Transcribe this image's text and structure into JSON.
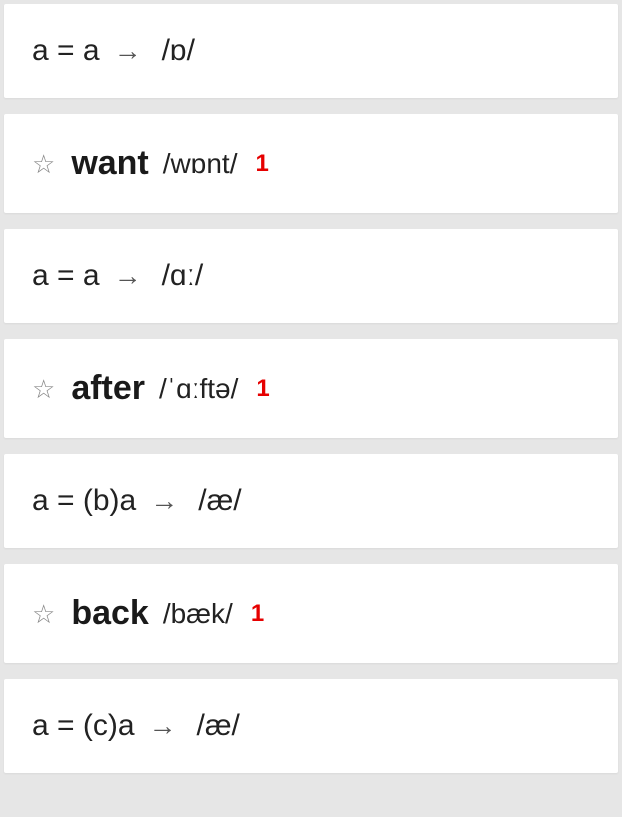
{
  "cards": [
    {
      "type": "rule",
      "lhs": "a = a",
      "arrow": "→",
      "phoneme": "/ɒ/"
    },
    {
      "type": "word",
      "star": "☆",
      "word": "want",
      "transcription": "/wɒnt/",
      "count": "1"
    },
    {
      "type": "rule",
      "lhs": "a = a",
      "arrow": "→",
      "phoneme": "/ɑː/"
    },
    {
      "type": "word",
      "star": "☆",
      "word": "after",
      "transcription": "/ˈɑːftə/",
      "count": "1"
    },
    {
      "type": "rule",
      "lhs": "a = (b)a",
      "arrow": "→",
      "phoneme": "/æ/"
    },
    {
      "type": "word",
      "star": "☆",
      "word": "back",
      "transcription": "/bæk/",
      "count": "1"
    },
    {
      "type": "rule",
      "lhs": "a = (c)a",
      "arrow": "→",
      "phoneme": "/æ/"
    }
  ]
}
